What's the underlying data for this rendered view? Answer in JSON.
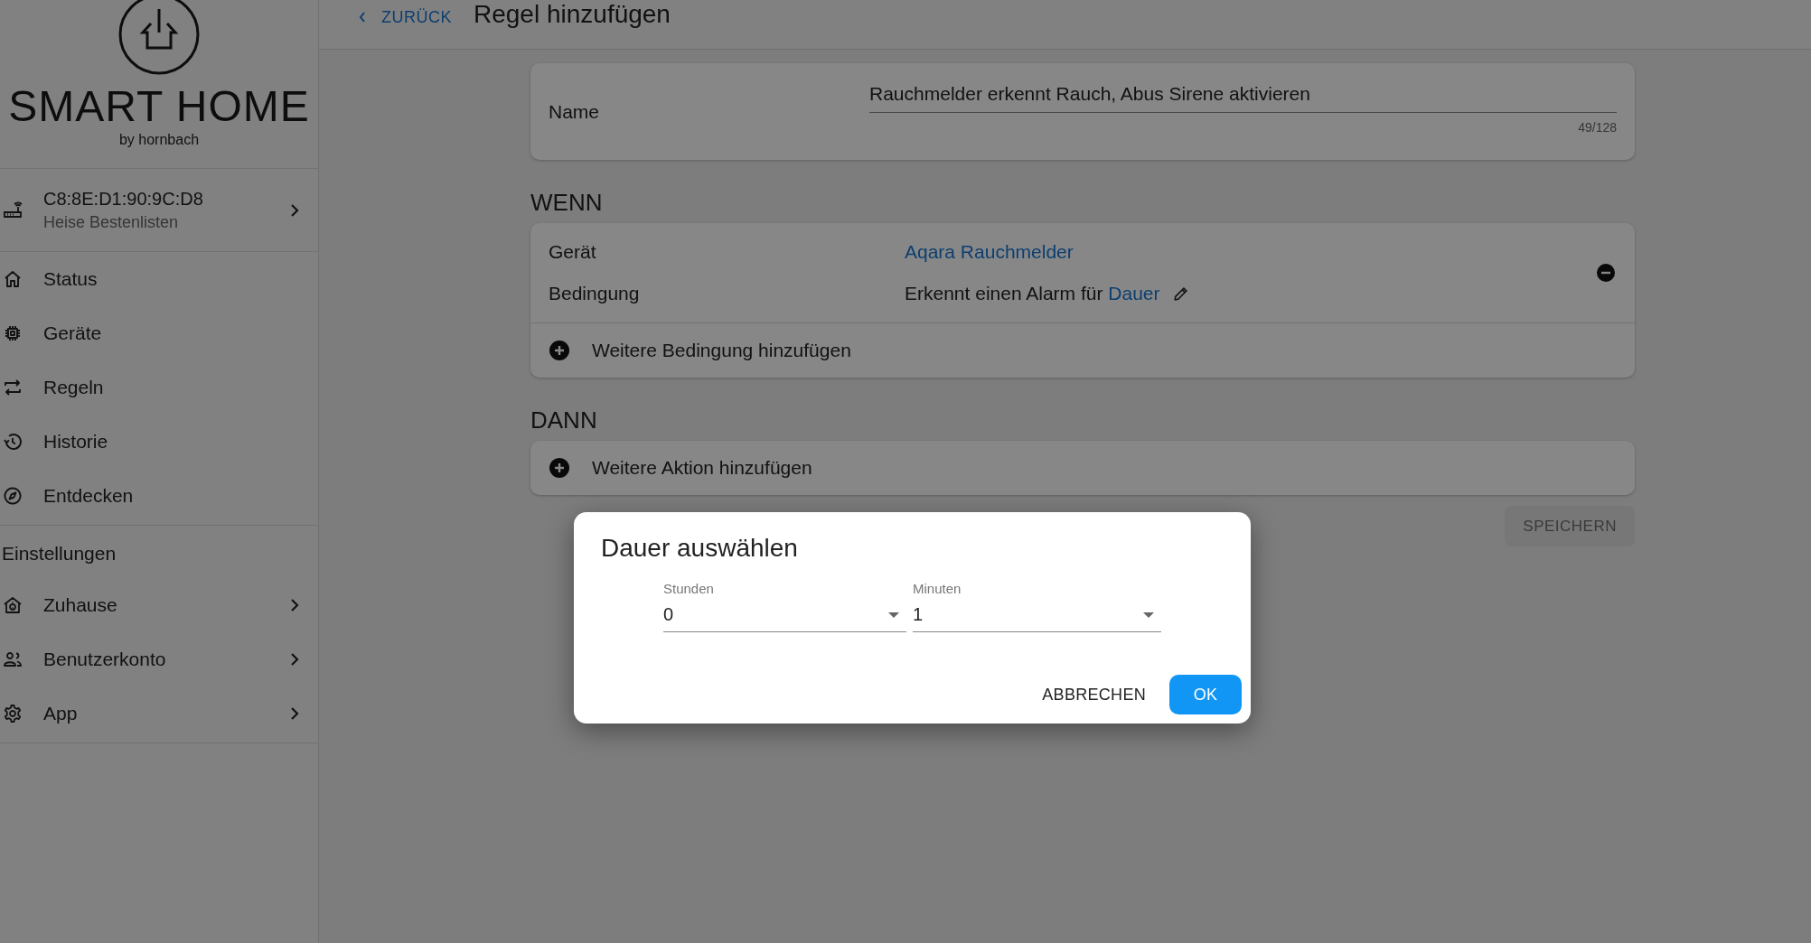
{
  "sidebar": {
    "logo_title": "SMART HOME",
    "logo_subtitle": "by hornbach",
    "device": {
      "address": "C8:8E:D1:90:9C:D8",
      "name": "Heise Bestenlisten",
      "expandable": true
    },
    "nav_items": [
      {
        "label": "Status",
        "expandable": false
      },
      {
        "label": "Geräte",
        "expandable": false
      },
      {
        "label": "Regeln",
        "expandable": false
      },
      {
        "label": "Historie",
        "expandable": false
      },
      {
        "label": "Entdecken",
        "expandable": false
      }
    ],
    "settings_heading": "Einstellungen",
    "settings_items": [
      {
        "label": "Zuhause",
        "expandable": true
      },
      {
        "label": "Benutzerkonto",
        "expandable": true
      },
      {
        "label": "App",
        "expandable": true
      }
    ]
  },
  "header": {
    "back": "ZURÜCK",
    "title": "Regel hinzufügen"
  },
  "name_card": {
    "label": "Name",
    "value": "Rauchmelder erkennt Rauch, Abus Sirene aktivieren",
    "counter": "49/128"
  },
  "when": {
    "heading": "WENN",
    "device_label": "Gerät",
    "device_value": "Aqara Rauchmelder",
    "condition_label": "Bedingung",
    "condition_text": "Erkennt einen Alarm für",
    "condition_link": "Dauer",
    "add": "Weitere Bedingung hinzufügen"
  },
  "then": {
    "heading": "DANN",
    "add": "Weitere Aktion hinzufügen"
  },
  "save_button": {
    "label": "SPEICHERN",
    "disabled": true
  },
  "dialog": {
    "title": "Dauer auswählen",
    "fields": [
      {
        "label": "Stunden",
        "value": "0"
      },
      {
        "label": "Minuten",
        "value": "1"
      }
    ],
    "buttons": [
      {
        "label": "ABBRECHEN",
        "kind": "text"
      },
      {
        "label": "OK",
        "kind": "primary"
      }
    ]
  }
}
